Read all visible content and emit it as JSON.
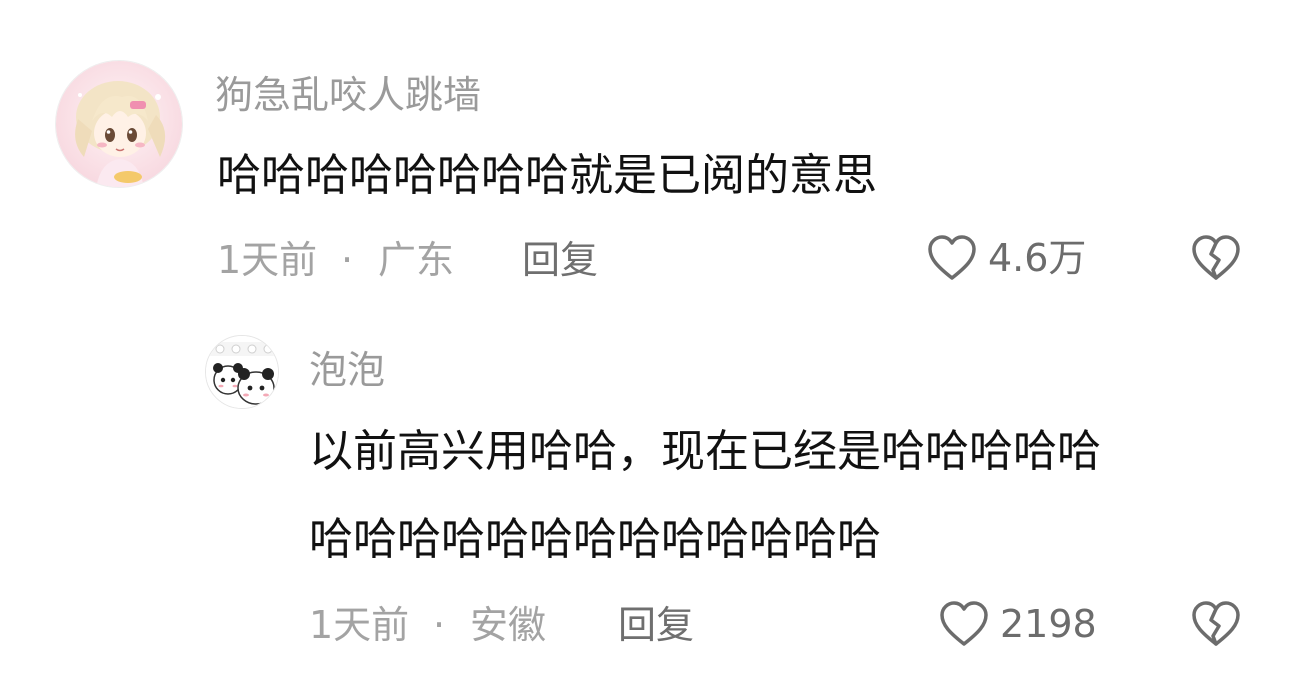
{
  "comments": [
    {
      "username": "狗急乱咬人跳墙",
      "content_lines": [
        "哈哈哈哈哈哈哈哈就是已阅的意思"
      ],
      "time": "1天前",
      "separator": "·",
      "location": "广东",
      "reply_label": "回复",
      "like_count": "4.6万",
      "avatar_icon": "anime-girl-avatar",
      "like_icon": "heart-outline-icon",
      "dislike_icon": "broken-heart-icon"
    },
    {
      "username": "泡泡",
      "content_lines": [
        "以前高兴用哈哈，现在已经是哈哈哈哈哈",
        "哈哈哈哈哈哈哈哈哈哈哈哈哈"
      ],
      "time": "1天前",
      "separator": "·",
      "location": "安徽",
      "reply_label": "回复",
      "like_count": "2198",
      "avatar_icon": "panda-sticker-avatar",
      "like_icon": "heart-outline-icon",
      "dislike_icon": "broken-heart-icon"
    }
  ],
  "colors": {
    "username": "#9a9a9a",
    "content": "#111111",
    "meta": "#a3a3a3",
    "reply": "#6f6f6f",
    "icon": "#6c6c6c"
  }
}
